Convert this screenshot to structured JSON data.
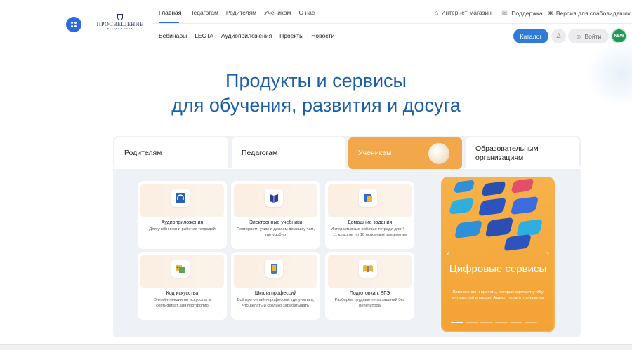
{
  "header": {
    "logo": {
      "name": "ПРОСВЕЩЕНИЕ",
      "sub": "ВСЕГДА В СЕТИ"
    },
    "top_nav": [
      "Главная",
      "Педагогам",
      "Родителям",
      "Ученикам",
      "О нас"
    ],
    "second_nav": [
      "Вебинары",
      "LECTA",
      "Аудиоприложения",
      "Проекты",
      "Новости"
    ],
    "utilities": {
      "shop": "Интернет-магазин",
      "support": "Поддержка",
      "accessibility": "Версия для слабовидящих"
    },
    "catalog_label": "Каталог",
    "login_label": "Войти",
    "new_badge": "NEW"
  },
  "hero": {
    "line1": "Продукты и сервисы",
    "line2": "для обучения, развития и досуга"
  },
  "tabs": [
    "Родителям",
    "Педагогам",
    "Ученикам",
    "Образовательным организациям"
  ],
  "active_tab": "Ученикам",
  "cards": [
    {
      "title": "Аудиоприложения",
      "desc": "Для учебников и рабочих тетрадей",
      "icon": "headphones-icon"
    },
    {
      "title": "Электронные учебники",
      "desc": "Повторяем, учим и делаем домашку там, где удобно",
      "icon": "book-icon"
    },
    {
      "title": "Домашние задания",
      "desc": "Интерактивные рабочие тетради для 4—11 классов по 16 основным предметам",
      "icon": "notebook-icon"
    },
    {
      "title": "Код искусства",
      "desc": "Онлайн-лекции по искусству и сертификат для портфолио",
      "icon": "art-icon"
    },
    {
      "title": "Школа профессий",
      "desc": "Всё про онлайн-профессии: где учиться, что делать и сколько зарабатывать",
      "icon": "phone-icon"
    },
    {
      "title": "Подготовка к ЕГЭ",
      "desc": "Разберём трудные типы заданий без репетитора",
      "icon": "open-book-icon"
    }
  ],
  "promo": {
    "title": "Цифровые сервисы",
    "desc": "Приложения и проекты, которые сделают учёбу интересней и проще. Аудио, тесты и тренажеры"
  },
  "colors": {
    "brand_blue": "#1c5ea8",
    "button_blue": "#2f7bd9",
    "accent_orange": "#f2a84a",
    "new_green": "#1f9a56"
  }
}
